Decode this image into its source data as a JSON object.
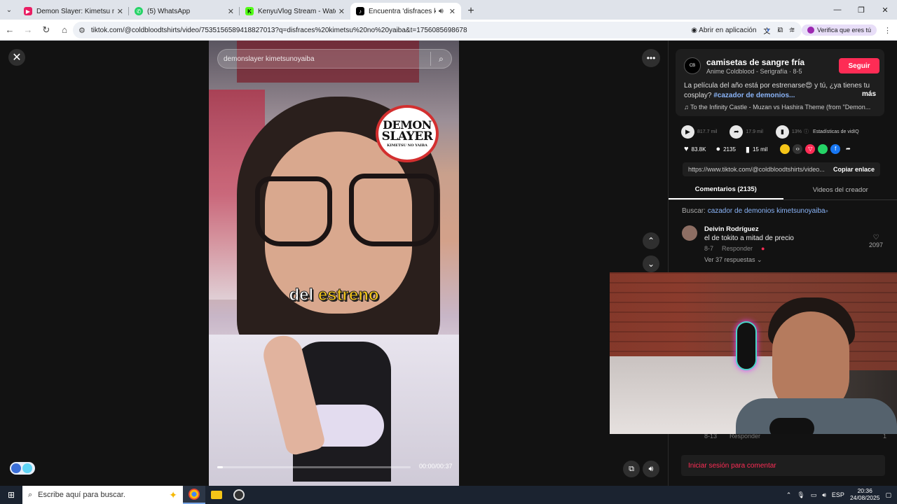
{
  "browser": {
    "tabs": [
      {
        "title": "Demon Slayer: Kimetsu no Yaiba",
        "favicon_color": "#e91e63",
        "active": false
      },
      {
        "title": "(5) WhatsApp",
        "favicon_color": "#25d366",
        "active": false
      },
      {
        "title": "KenyuVlog Stream - Watch Live",
        "favicon_color": "#53fc18",
        "active": false
      },
      {
        "title": "Encuentra 'disfraces kimetsu",
        "favicon_color": "#000000",
        "active": true
      }
    ],
    "new_tab": "+",
    "url": "tiktok.com/@coldbloodtshirts/video/7535156589418827013?q=disfraces%20kimetsu%20no%20yaiba&t=1756085698678",
    "open_in_app": "Abrir en aplicación",
    "verify_label": "Verifica que eres tú"
  },
  "video": {
    "search_text": "demonslayer kimetsunoyaiba",
    "logo": {
      "line1": "DEMON",
      "line2": "SLAYER",
      "line3": "KIMETSU NO YAIBA"
    },
    "caption_word1": "del",
    "caption_word2": "estreno",
    "progress_fraction": 0.03,
    "time": "00:00/00:37"
  },
  "panel": {
    "author_name": "camisetas de sangre fría",
    "author_sub": "Anime Coldblood - Serigrafía · 8-5",
    "follow_label": "Seguir",
    "description": "La película del año está por estrenarse😍 y tú, ¿ya tienes tu cosplay?",
    "hashtag": "#cazador de demonios...",
    "more_label": "más",
    "music": "♫  To the Infinity Castle - Muzan vs Hashira Theme (from \"Demon...",
    "stats": {
      "plays": "817.7 mil",
      "shares": "17.9 mil",
      "rate": "13%",
      "vidiq_label": "Estadísticas de vidIQ"
    },
    "likes": "83.8K",
    "comments_count": "2135",
    "saves": "15 mil",
    "link": "https://www.tiktok.com/@coldbloodtshirts/video...",
    "copy_label": "Copiar enlace",
    "tab_comments": "Comentarios (2135)",
    "tab_creator": "Videos del creador",
    "search_prefix": "Buscar:",
    "search_query": "cazador de demonios kimetsunoyaiba",
    "comment": {
      "name": "Deivin Rodríguez",
      "text": "el de tokito a mitad de precio",
      "date": "8-7",
      "reply": "Responder",
      "likes": "2097",
      "replies": "Ver 37 respuestas ⌄"
    },
    "comment2_meta": {
      "date": "8-13",
      "reply": "Responder",
      "likes": "1"
    },
    "login_label": "Iniciar sesión para comentar"
  },
  "taskbar": {
    "search_placeholder": "Escribe aquí para buscar.",
    "lang": "ESP",
    "time": "20:36",
    "date": "24/08/2025"
  },
  "colors": {
    "accent": "#fe2c55",
    "link": "#8ab4f8",
    "caption_highlight": "#f5c518"
  }
}
